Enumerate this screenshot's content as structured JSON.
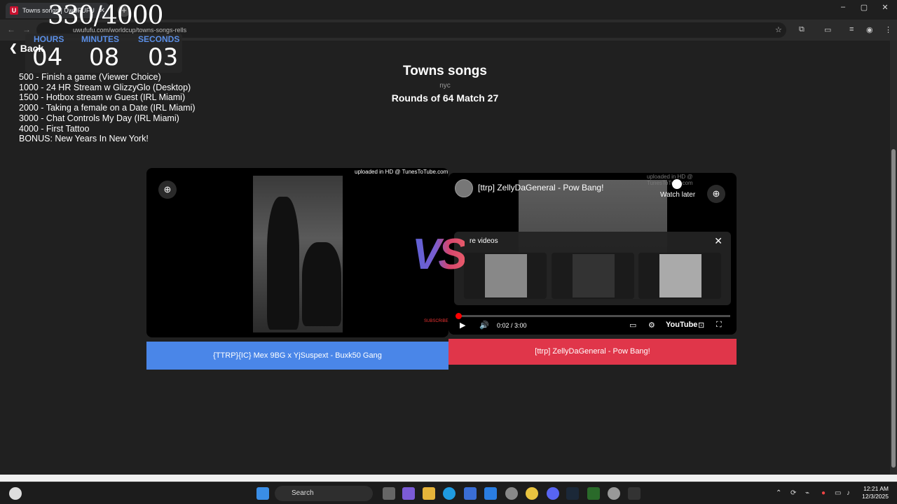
{
  "browser": {
    "tab_title": "Towns songs | UwUFUFU",
    "tab_close": "✕",
    "new_tab": "+",
    "url": "uwufufu.com/worldcup/towns-songs-rells",
    "minimize": "–",
    "maximize": "▢",
    "close": "✕"
  },
  "overlay": {
    "counter": "330/4000",
    "hours_label": "HOURS",
    "minutes_label": "MINUTES",
    "seconds_label": "SECONDS",
    "hours": "04",
    "minutes": "08",
    "seconds": "03"
  },
  "nav": {
    "back_label": "Back"
  },
  "goals": [
    " 500 -  Finish a game (Viewer Choice)",
    "1000 - 24 HR Stream w GlizzyGlo (Desktop)",
    "1500 - Hotbox stream w Guest (IRL Miami)",
    "2000 - Taking a female on a Date (IRL Miami)",
    "3000 - Chat Controls My Day (IRL Miami)",
    "4000 - First Tattoo",
    "BONUS: New Years In New York!"
  ],
  "header": {
    "title": "Towns songs",
    "subtitle": "nyc",
    "round": "Rounds of 64 Match 27"
  },
  "left_video": {
    "watermark": "uploaded in HD @ TunesToTube.com",
    "subscribe": "SUBSCRIBE",
    "choice_label": "{TTRP}{IC} Mex 9BG x YjSuspext - Buxk50 Gang"
  },
  "vs_label": "VS",
  "right_video": {
    "watermark": "uploaded in HD @ TunesToTube.com",
    "title": "[ttrp] ZellyDaGeneral - Pow Bang!",
    "watch_later": "Watch later",
    "more_videos": "re videos",
    "time": "0:02 / 3:00",
    "progress": 0.011,
    "youtube": "YouTube",
    "choice_label": "[ttrp] ZellyDaGeneral - Pow Bang!"
  },
  "taskbar": {
    "search": "Search",
    "time": "12:21 AM",
    "date": "12/3/2025"
  },
  "colors": {
    "left_choice": "#4a86e8",
    "right_choice": "#e0364a",
    "timer_label": "#5b8fe6"
  }
}
